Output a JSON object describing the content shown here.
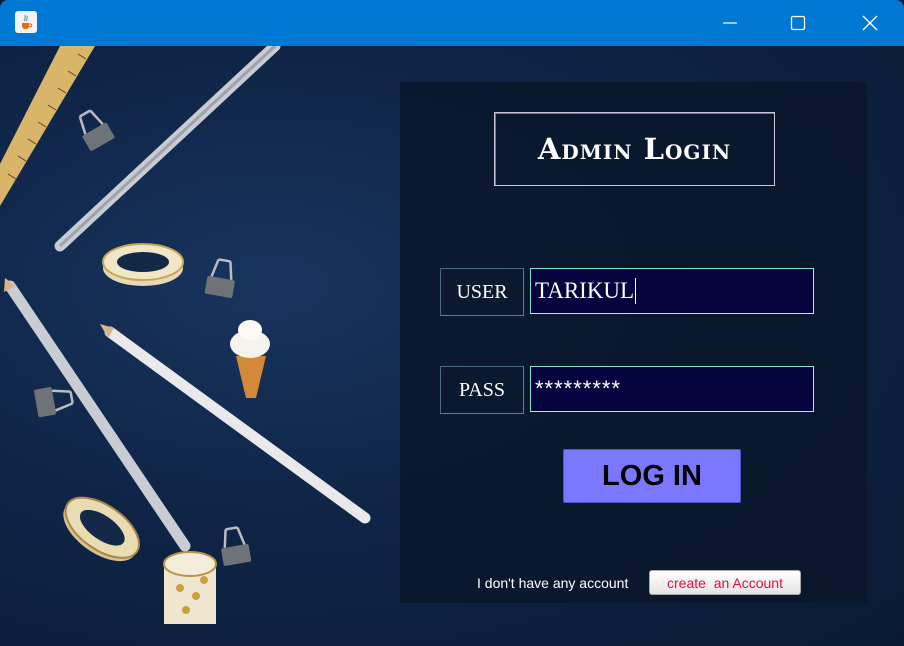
{
  "window": {
    "app_icon": "java-coffee-icon",
    "controls": {
      "minimize_icon": "minimize-icon",
      "maximize_icon": "maximize-icon",
      "close_icon": "close-icon"
    },
    "titlebar_color": "#0078d4"
  },
  "form": {
    "title": "Admin Login",
    "user_label": "USER",
    "user_value": "TARIKUL",
    "pass_label": "PASS",
    "pass_value": "*********",
    "login_button": "LOG IN",
    "no_account_text": "I don't have any account",
    "create_account_button": "create  an Account"
  },
  "colors": {
    "panel_bg": "#0a162a",
    "input_bg": "#05043e",
    "login_button_bg": "#7b78ff",
    "create_account_text": "#e0103a"
  }
}
